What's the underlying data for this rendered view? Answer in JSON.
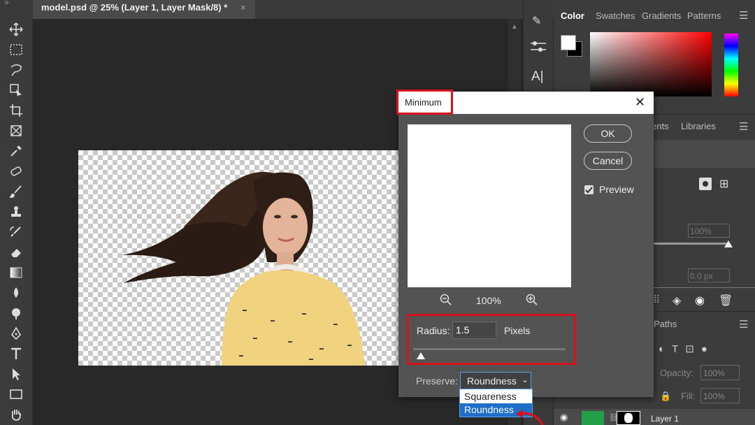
{
  "document_tab": {
    "title": "model.psd @ 25% (Layer 1, Layer Mask/8) *",
    "close": "×"
  },
  "toolbar": {
    "tools": [
      "move-tool",
      "rectangular-marquee-tool",
      "lasso-tool",
      "object-selection-tool",
      "crop-tool",
      "frame-tool",
      "eyedropper-tool",
      "healing-brush-tool",
      "brush-tool",
      "clone-stamp-tool",
      "history-brush-tool",
      "eraser-tool",
      "gradient-tool",
      "blur-tool",
      "dodge-tool",
      "pen-tool",
      "type-tool",
      "path-selection-tool",
      "rectangle-tool",
      "hand-tool"
    ]
  },
  "panels": {
    "color_tabs": [
      "Color",
      "Swatches",
      "Gradients",
      "Patterns"
    ],
    "second_tabs": [
      "ents",
      "Libraries"
    ],
    "layers_labels": {
      "paths_tab": "Paths",
      "opacity_label": "Opacity:",
      "opacity_value": "100%",
      "fill_label": "Fill:",
      "fill_value": "100%",
      "layer_name": "Layer 1",
      "density_value": "100%",
      "feather_value": "0.0 px"
    }
  },
  "dialog": {
    "title": "Minimum",
    "close": "✕",
    "ok_label": "OK",
    "cancel_label": "Cancel",
    "preview_label": "Preview",
    "preview_checked": true,
    "zoom_value": "100%",
    "radius_label": "Radius:",
    "radius_value": "1.5",
    "radius_unit": "Pixels",
    "radius_slider_fraction": 0.05,
    "preserve_label": "Preserve:",
    "preserve_selected": "Roundness",
    "preserve_options": [
      "Squareness",
      "Roundness"
    ]
  },
  "colors": {
    "accent_red": "#d7121b",
    "selection_blue": "#1f6fc9"
  }
}
